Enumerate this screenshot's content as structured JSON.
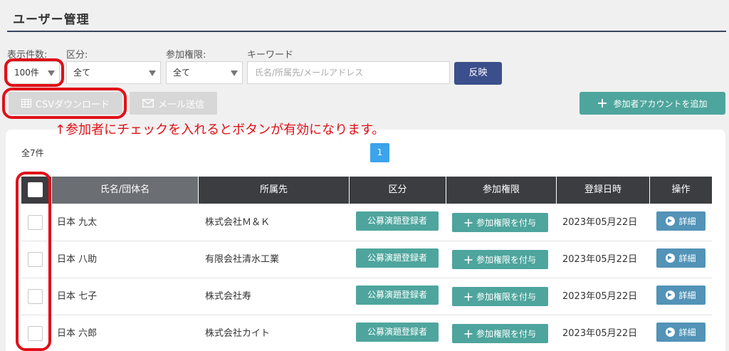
{
  "page": {
    "title": "ユーザー管理"
  },
  "filters": {
    "count_label": "表示件数:",
    "count_value": "100件",
    "category_label": "区分:",
    "category_value": "全て",
    "permission_label": "参加権限:",
    "permission_value": "全て",
    "keyword_label": "キーワード",
    "keyword_placeholder": "氏名/所属先/メールアドレス",
    "apply_label": "反映"
  },
  "actions": {
    "csv_label": "CSVダウンロード",
    "mail_label": "メール送信",
    "add_label": "参加者アカウントを追加",
    "csv_icon": "table-icon",
    "mail_icon": "envelope-icon",
    "add_icon": "plus-icon"
  },
  "annotation": {
    "text": "↑参加者にチェックを入れるとボタンが有効になります。",
    "color": "#e01018"
  },
  "list": {
    "total": "全7件",
    "current_page": "1",
    "columns": [
      "氏名/団体名",
      "所属先",
      "区分",
      "参加権限",
      "登録日時",
      "操作"
    ],
    "grant_label": "参加権限を付与",
    "detail_label": "詳細",
    "rows": [
      {
        "name": "日本 九太",
        "org": "株式会社Ｍ＆Ｋ",
        "category": "公募演題登録者",
        "date": "2023年05月22日"
      },
      {
        "name": "日本 八助",
        "org": "有限会社清水工業",
        "category": "公募演題登録者",
        "date": "2023年05月22日"
      },
      {
        "name": "日本 七子",
        "org": "株式会社寿",
        "category": "公募演題登録者",
        "date": "2023年05月22日"
      },
      {
        "name": "日本 六郎",
        "org": "株式会社カイト",
        "category": "公募演題登録者",
        "date": "2023年05月22日"
      }
    ]
  },
  "colors": {
    "primary_navy": "#3b4f8c",
    "teal": "#4ea59d",
    "detail_blue": "#5293b7",
    "header_dark": "#3b3d40",
    "pager_blue": "#3ba4ec"
  }
}
